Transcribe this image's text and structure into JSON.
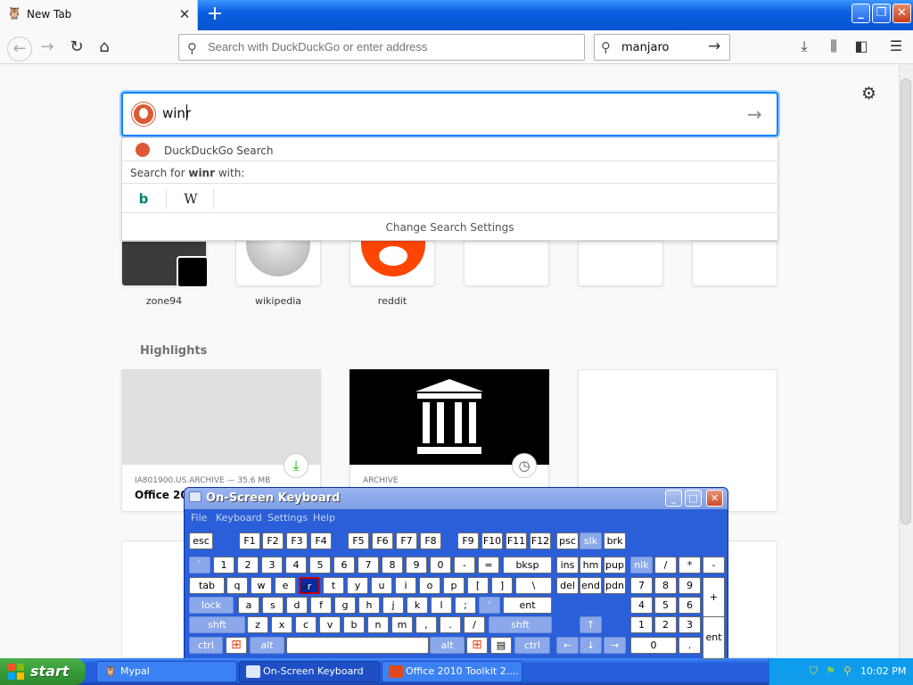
{
  "browser": {
    "tab_title": "New Tab",
    "tab_close": "✕",
    "new_tab": "+",
    "window_buttons": {
      "min": "_",
      "max": "❐",
      "close": "✕"
    },
    "url_placeholder": "Search with DuckDuckGo or enter address",
    "search_value": "manjaro"
  },
  "newtab": {
    "search_value": "winr",
    "suggest": {
      "engine_label": "DuckDuckGo Search",
      "search_for_prefix": "Search for ",
      "search_for_term": "winr",
      "search_for_suffix": " with:",
      "bing": "b",
      "wiki": "W",
      "change_settings": "Change Search Settings"
    },
    "top_sites": [
      {
        "label": "zone94"
      },
      {
        "label": "wikipedia"
      },
      {
        "label": "reddit"
      }
    ],
    "highlights_title": "Highlights",
    "highlights": [
      {
        "meta": "IA801900.US.ARCHIVE — 35.6 MB",
        "title": "Office 201"
      },
      {
        "meta": "ARCHIVE",
        "title": ""
      }
    ]
  },
  "osk": {
    "title": "On-Screen Keyboard",
    "menu": [
      "File",
      "Keyboard",
      "Settings",
      "Help"
    ],
    "pressed_key": "r",
    "rows": {
      "fn": [
        "esc",
        "F1",
        "F2",
        "F3",
        "F4",
        "F5",
        "F6",
        "F7",
        "F8",
        "F9",
        "F10",
        "F11",
        "F12",
        "psc",
        "slk",
        "brk"
      ],
      "num": [
        "`",
        "1",
        "2",
        "3",
        "4",
        "5",
        "6",
        "7",
        "8",
        "9",
        "0",
        "-",
        "=",
        "bksp",
        "ins",
        "hm",
        "pup",
        "nlk",
        "/",
        "*",
        "-"
      ],
      "tab": [
        "tab",
        "q",
        "w",
        "e",
        "r",
        "t",
        "y",
        "u",
        "i",
        "o",
        "p",
        "[",
        "]",
        "\\",
        "del",
        "end",
        "pdn",
        "7",
        "8",
        "9",
        "+"
      ],
      "caps": [
        "lock",
        "a",
        "s",
        "d",
        "f",
        "g",
        "h",
        "j",
        "k",
        "l",
        ";",
        "'",
        "ent",
        "4",
        "5",
        "6"
      ],
      "shift": [
        "shft",
        "z",
        "x",
        "c",
        "v",
        "b",
        "n",
        "m",
        ",",
        ".",
        "/",
        "shft",
        "↑",
        "1",
        "2",
        "3",
        "ent"
      ],
      "ctrl": [
        "ctrl",
        "⊞",
        "alt",
        "",
        "alt",
        "⊞",
        "▤",
        "ctrl",
        "←",
        "↓",
        "→",
        "0",
        "."
      ]
    }
  },
  "taskbar": {
    "start": "start",
    "tasks": [
      "Mypal",
      "On-Screen Keyboard",
      "Office 2010 Toolkit 2...."
    ],
    "clock": "10:02 PM"
  }
}
